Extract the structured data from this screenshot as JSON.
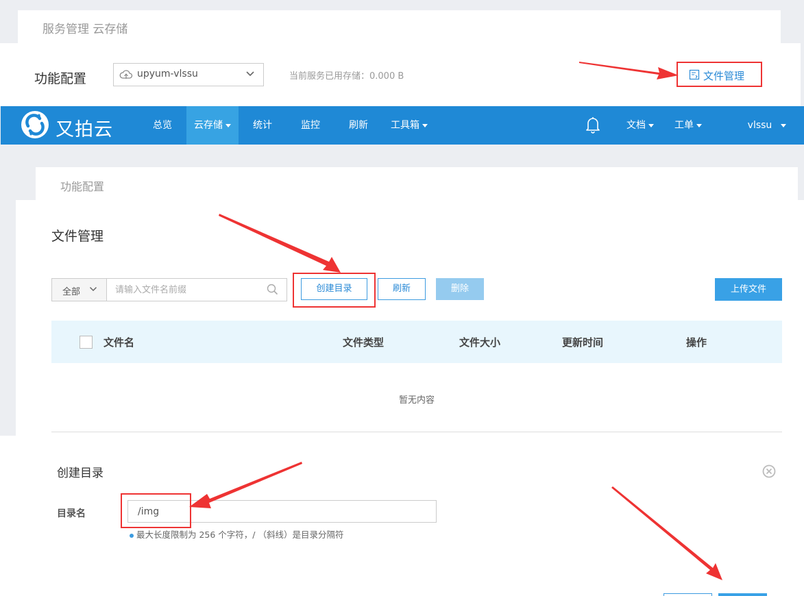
{
  "panel1": {
    "breadcrumb": "服务管理 云存储",
    "label": "功能配置",
    "service_select": "upyum-vlssu",
    "usage_text": "当前服务已用存储：0.000 B",
    "file_manage_link": "文件管理"
  },
  "navbar": {
    "brand": "又拍云",
    "items": [
      "总览",
      "云存储",
      "统计",
      "监控",
      "刷新",
      "工具箱"
    ],
    "right_items": [
      "文档",
      "工单"
    ],
    "user": "vlssu",
    "colors": {
      "bar": "#1f89d6",
      "active": "#37a3e3"
    }
  },
  "panel2": {
    "breadcrumb": "功能配置",
    "title": "文件管理",
    "filter_select": "全部",
    "search_placeholder": "请输入文件名前缀",
    "create_dir": "创建目录",
    "refresh": "刷新",
    "delete": "删除",
    "upload": "上传文件",
    "columns": [
      "文件名",
      "文件类型",
      "文件大小",
      "更新时间",
      "操作"
    ],
    "empty_text": "暂无内容"
  },
  "dialog": {
    "title": "创建目录",
    "field_label": "目录名",
    "field_value": "/img",
    "hint": "最大长度限制为 256 个字符，/ （斜线）是目录分隔符"
  },
  "icons": [
    "cloud-icon",
    "chevron-down-icon",
    "file-manage-icon",
    "logo-icon",
    "bell-icon",
    "search-icon",
    "close-circle-icon"
  ],
  "annotation_color": "#e33"
}
